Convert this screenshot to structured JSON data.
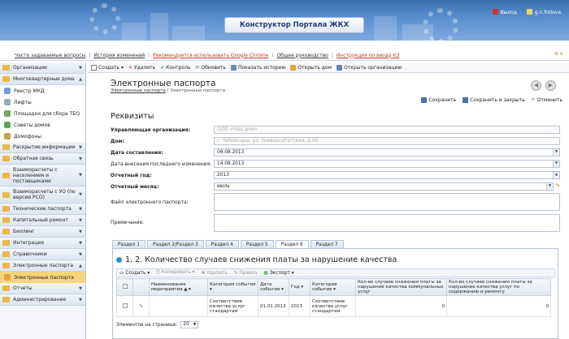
{
  "header": {
    "portal_title": "Конструктор Портала ЖКХ",
    "logout_label": "Выход",
    "user_label": "g.n.frolova"
  },
  "topnav": {
    "items": [
      {
        "label": "Часто задаваемые вопросы"
      },
      {
        "label": "История изменений"
      },
      {
        "label": "Рекомендуется использовать Google Chrome"
      },
      {
        "label": "Общее руководство"
      },
      {
        "label": "Инструкция по вводу КЗ"
      }
    ]
  },
  "sidebar": {
    "items": [
      {
        "label": "Организации"
      },
      {
        "label": "Многоквартирные дома"
      },
      {
        "label": "Реестр МКД"
      },
      {
        "label": "Лифты"
      },
      {
        "label": "Площадки для сбора ТБО"
      },
      {
        "label": "Советы домов"
      },
      {
        "label": "Домофоны"
      },
      {
        "label": "Раскрытие информации"
      },
      {
        "label": "Обратная связь"
      },
      {
        "label": "Взаиморасчеты с населением и поставщиками"
      },
      {
        "label": "Взаиморасчеты с УО (по версии РСО)"
      },
      {
        "label": "Технические паспорта"
      },
      {
        "label": "Капитальный ремонт"
      },
      {
        "label": "Биллинг"
      },
      {
        "label": "Интеграция"
      },
      {
        "label": "Справочники"
      },
      {
        "label": "Электронные паспорта"
      },
      {
        "label": "Электронные паспорта"
      },
      {
        "label": "Отчеты"
      },
      {
        "label": "Администрирование"
      }
    ]
  },
  "toolbar": {
    "create": "Создать",
    "delete": "Удалить",
    "control": "Контроль",
    "refresh": "Обновить",
    "history": "Показать историю",
    "open_house": "Открыть дом",
    "open_org": "Открыть организацию"
  },
  "page": {
    "title": "Электронные паспорта",
    "breadcrumb_link": "Электронные паспорта",
    "breadcrumb_current": "Электронные паспорта",
    "save": "Сохранить",
    "save_close": "Сохранить и закрыть",
    "cancel": "Отменить",
    "section_title": "Реквизиты"
  },
  "form": {
    "org_label": "Управляющая организация:",
    "org_value": "ООО «Наш дом»",
    "house_label": "Дом:",
    "house_value": "г. Чебоксары, ул. Университетская, д.26",
    "compiled_label": "Дата составления:",
    "compiled_value": "06.08.2013",
    "modified_label": "Дата внесения последнего изменения:",
    "modified_value": "14.08.2013",
    "year_label": "Отчетный год:",
    "year_value": "2013",
    "month_label": "Отчетный месяц:",
    "month_value": "июль",
    "file_label": "Файл электронного паспорта:",
    "note_label": "Примечание:"
  },
  "tabs": [
    {
      "label": "Раздел 1"
    },
    {
      "label": "Раздел 2/Раздел 3"
    },
    {
      "label": "Раздел 4"
    },
    {
      "label": "Раздел 5"
    },
    {
      "label": "Раздел 6"
    },
    {
      "label": "Раздел 7"
    }
  ],
  "section": {
    "title": "1, 2. Количество случаев снижения платы за нарушение качества",
    "grid_toolbar": {
      "create": "Создать",
      "copy": "Копировать",
      "delete": "Удалить",
      "edit": "Правка",
      "export": "Экспорт"
    },
    "columns": [
      "Наименование мероприятия",
      "Категория события",
      "Дата события",
      "Год",
      "Категория события",
      "Кол-во случаев снижения платы за нарушение качества коммунальных услуг",
      "Кол-во случаев снижения платы за нарушение качества услуг по содержанию и ремонту"
    ],
    "rows": [
      {
        "name": "",
        "category": "Соответствие качества услуг стандартам",
        "date": "01.01.2013",
        "year": "2013",
        "category2": "Соответствие качества услуг стандартам",
        "count_utilities": "0",
        "count_maintenance": "0"
      }
    ],
    "pager_label": "Элементов на странице:",
    "page_size": "20"
  },
  "colors": {
    "header_blue": "#3a6fb0",
    "accent_red": "#c0392b",
    "active_yellow": "#f5d67b"
  }
}
